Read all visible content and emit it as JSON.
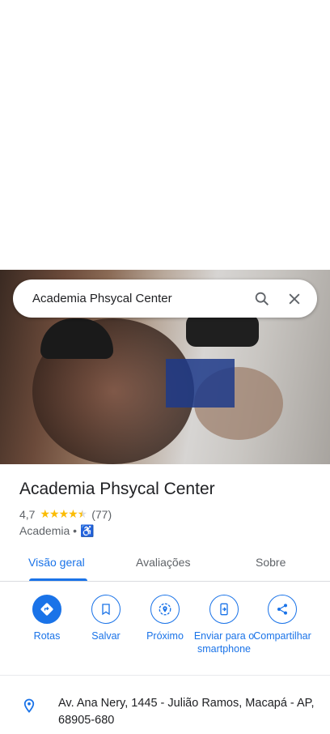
{
  "search": {
    "query": "Academia Phsycal Center"
  },
  "place": {
    "name": "Academia Phsycal Center",
    "rating": "4,7",
    "rating_value": 4.7,
    "review_count": "(77)",
    "category": "Academia",
    "separator": "•",
    "wheelchair_icon": "wheelchair-accessible-icon"
  },
  "tabs": [
    {
      "label": "Visão geral",
      "active": true
    },
    {
      "label": "Avaliações"
    },
    {
      "label": "Sobre"
    }
  ],
  "actions": [
    {
      "label": "Rotas",
      "icon": "directions-icon"
    },
    {
      "label": "Salvar",
      "icon": "bookmark-icon"
    },
    {
      "label": "Próximo",
      "icon": "nearby-icon"
    },
    {
      "label": "Enviar para o smartphone",
      "icon": "send-to-phone-icon"
    },
    {
      "label": "Compartilhar",
      "icon": "share-icon"
    }
  ],
  "address": "Av. Ana Nery, 1445 - Julião Ramos, Macapá - AP, 68905-680",
  "colors": {
    "accent": "#1a73e8",
    "star": "#fbbc04"
  }
}
